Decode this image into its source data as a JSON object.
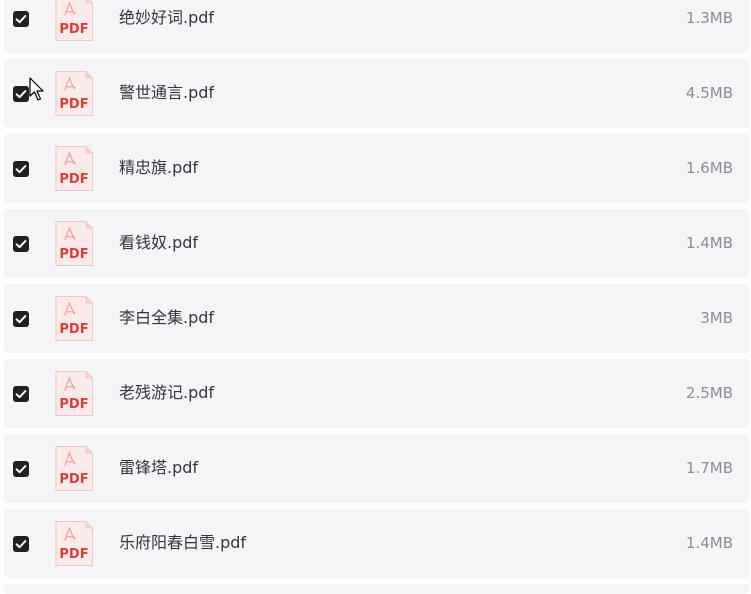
{
  "files": [
    {
      "name": "绝妙好词.pdf",
      "size": "1.3MB",
      "checked": true
    },
    {
      "name": "警世通言.pdf",
      "size": "4.5MB",
      "checked": true
    },
    {
      "name": "精忠旗.pdf",
      "size": "1.6MB",
      "checked": true
    },
    {
      "name": "看钱奴.pdf",
      "size": "1.4MB",
      "checked": true
    },
    {
      "name": "李白全集.pdf",
      "size": "3MB",
      "checked": true
    },
    {
      "name": "老残游记.pdf",
      "size": "2.5MB",
      "checked": true
    },
    {
      "name": "雷锋塔.pdf",
      "size": "1.7MB",
      "checked": true
    },
    {
      "name": "乐府阳春白雪.pdf",
      "size": "1.4MB",
      "checked": true
    }
  ],
  "icon": {
    "type": "pdf-file-icon",
    "label": "PDF",
    "color": "#e03b3b"
  },
  "colors": {
    "row_bg": "#f5f5f7",
    "checkbox": "#1f1f24",
    "name_text": "#33363d",
    "size_text": "#8a8d94"
  }
}
